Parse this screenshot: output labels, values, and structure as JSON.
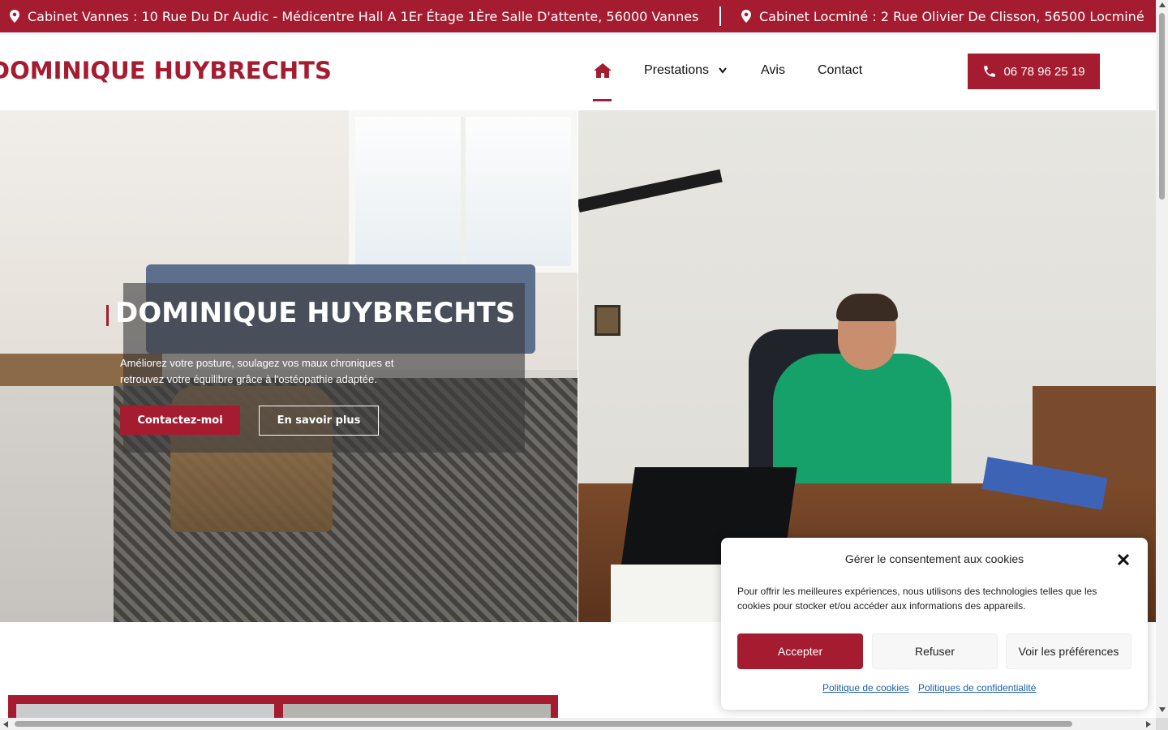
{
  "colors": {
    "brand": "#a51c30",
    "link": "#1e60a8"
  },
  "topbar": {
    "address_1": "Cabinet Vannes : 10 Rue Du Dr Audic - Médicentre Hall A 1Er Étage 1Ère Salle D'attente, 56000 Vannes",
    "address_2": "Cabinet Locminé : 2 Rue Olivier De Clisson, 56500 Locminé",
    "icon": "map-pin-icon"
  },
  "header": {
    "logo_text": "DOMINIQUE HUYBRECHTS",
    "nav": {
      "home_icon": "home-icon",
      "prestations": "Prestations",
      "avis": "Avis",
      "contact": "Contact"
    },
    "phone": "06 78 96 25 19",
    "phone_icon": "phone-icon"
  },
  "hero": {
    "title": "DOMINIQUE HUYBRECHTS",
    "subtitle": "Améliorez votre posture, soulagez vos maux chroniques et retrouvez votre équilibre grâce à l'ostéopathie adaptée.",
    "btn_contact": "Contactez-moi",
    "btn_more": "En savoir plus"
  },
  "cookie": {
    "title": "Gérer le consentement aux cookies",
    "text": "Pour offrir les meilleures expériences, nous utilisons des technologies telles que les cookies pour stocker et/ou accéder aux informations des appareils.",
    "accept": "Accepter",
    "refuse": "Refuser",
    "preferences": "Voir les préférences",
    "link_cookies": "Politique de cookies",
    "link_privacy": "Politiques de confidentialité"
  }
}
